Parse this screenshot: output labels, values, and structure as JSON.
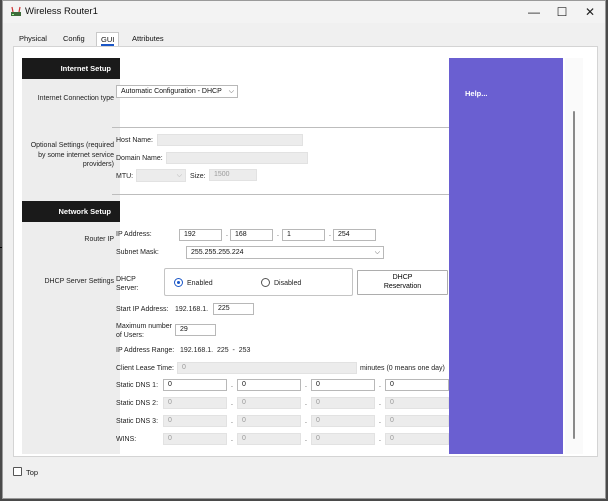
{
  "window": {
    "title": "Wireless Router1",
    "minimize": "—",
    "maximize": "☐",
    "close": "✕"
  },
  "tabs": [
    {
      "label": "Physical"
    },
    {
      "label": "Config"
    },
    {
      "label": "GUI"
    },
    {
      "label": "Attributes"
    }
  ],
  "active_tab": "GUI",
  "internet_setup": {
    "header": "Internet Setup",
    "connection_type_label": "Internet Connection type",
    "connection_type_value": "Automatic Configuration - DHCP",
    "optional_label": "Optional Settings (required by some internet service providers)",
    "host_name_label": "Host Name:",
    "domain_name_label": "Domain Name:",
    "mtu_label": "MTU:",
    "size_label": "Size:",
    "size_value": "1500"
  },
  "network_setup": {
    "header": "Network Setup",
    "router_ip_label": "Router IP",
    "ip_address_label": "IP Address:",
    "ip": [
      "192",
      "168",
      "1",
      "254"
    ],
    "subnet_mask_label": "Subnet Mask:",
    "subnet_mask_value": "255.255.255.224",
    "dhcp_side_label": "DHCP Server Settings",
    "dhcp_server_label": "DHCP Server:",
    "enabled_label": "Enabled",
    "disabled_label": "Disabled",
    "dhcp_enabled": true,
    "reservation_button": "DHCP Reservation",
    "start_ip_label": "Start IP Address:",
    "start_ip_prefix": "192.168.1.",
    "start_ip_value": "225",
    "max_users_label": "Maximum number of Users:",
    "max_users_value": "29",
    "ip_range_label": "IP Address Range:",
    "ip_range_value": "192.168.1.  225  -  253",
    "lease_label": "Client Lease Time:",
    "lease_value": "0",
    "lease_suffix": "minutes (0 means one day)",
    "dns1_label": "Static DNS 1:",
    "dns1": [
      "0",
      "0",
      "0",
      "0"
    ],
    "dns2_label": "Static DNS 2:",
    "dns2": [
      "0",
      "0",
      "0",
      "0"
    ],
    "dns3_label": "Static DNS 3:",
    "dns3": [
      "0",
      "0",
      "0",
      "0"
    ],
    "wins_label": "WINS:",
    "wins": [
      "0",
      "0",
      "0",
      "0"
    ]
  },
  "help": {
    "label": "Help..."
  },
  "footer": {
    "top_label": "Top",
    "top_checked": false
  }
}
